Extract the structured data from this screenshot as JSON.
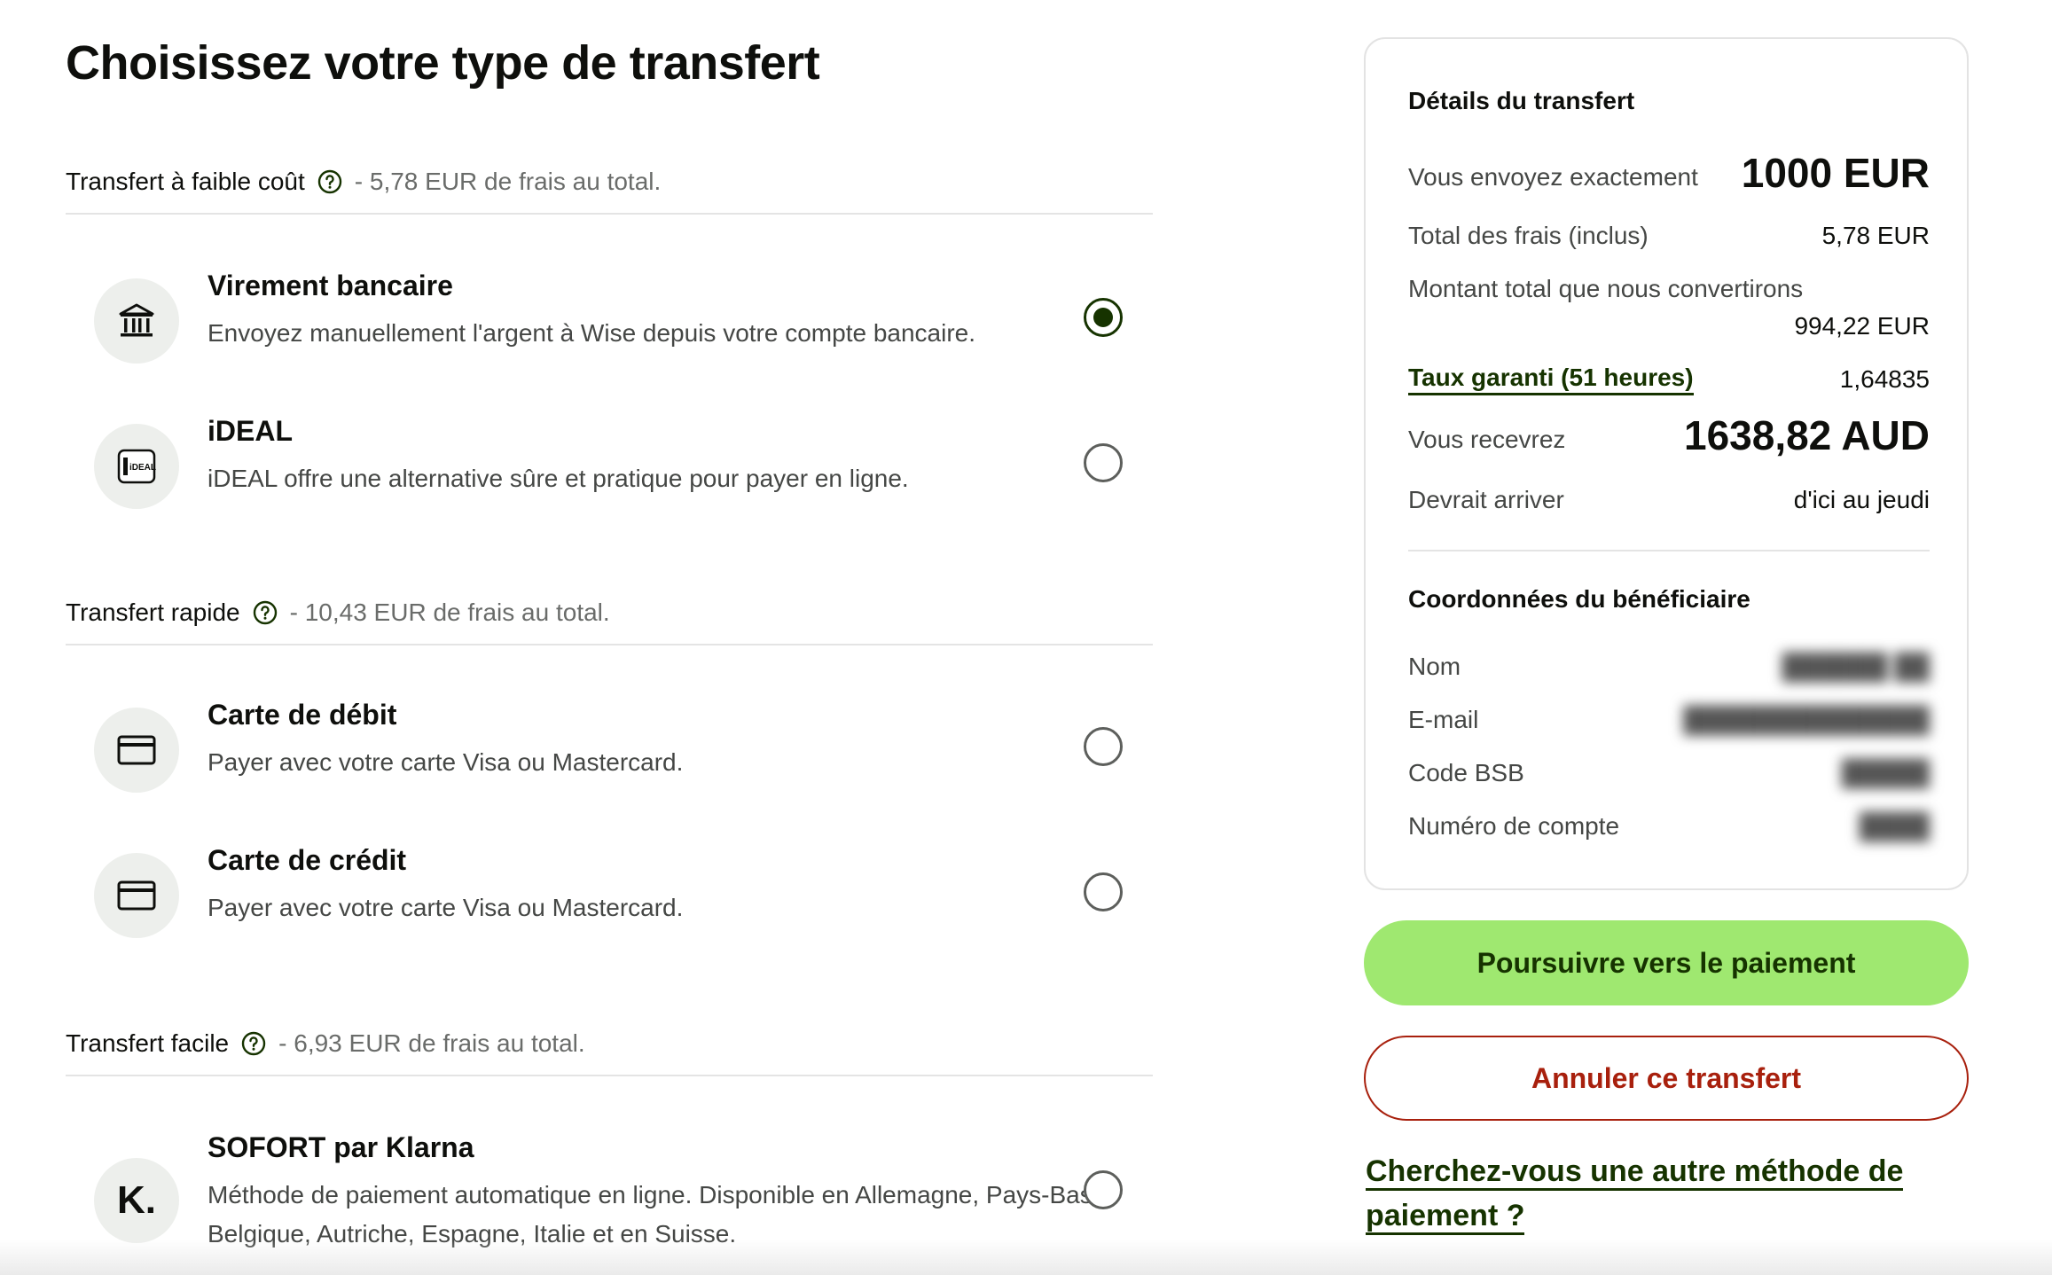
{
  "page_title": "Choisissez votre type de transfert",
  "groups": [
    {
      "title": "Transfert à faible coût",
      "fee": "- 5,78 EUR de frais au total.",
      "options": [
        {
          "title": "Virement bancaire",
          "description": "Envoyez manuellement l'argent à Wise depuis votre compte bancaire.",
          "icon": "bank-icon",
          "selected": true
        },
        {
          "title": "iDEAL",
          "description": "iDEAL offre une alternative sûre et pratique pour payer en ligne.",
          "icon": "ideal-logo-icon",
          "icon_text": "iDEAL",
          "selected": false
        }
      ]
    },
    {
      "title": "Transfert rapide",
      "fee": "- 10,43 EUR de frais au total.",
      "options": [
        {
          "title": "Carte de débit",
          "description": "Payer avec votre carte Visa ou Mastercard.",
          "icon": "card-icon",
          "selected": false
        },
        {
          "title": "Carte de crédit",
          "description": "Payer avec votre carte Visa ou Mastercard.",
          "icon": "card-icon",
          "selected": false
        }
      ]
    },
    {
      "title": "Transfert facile",
      "fee": "- 6,93 EUR de frais au total.",
      "options": [
        {
          "title": "SOFORT par Klarna",
          "description": "Méthode de paiement automatique en ligne. Disponible en Allemagne, Pays-Bas, Belgique, Autriche, Espagne, Italie et en Suisse.",
          "icon": "klarna-logo-icon",
          "icon_text": "K.",
          "selected": false
        }
      ]
    }
  ],
  "details": {
    "title": "Détails du transfert",
    "send_label": "Vous envoyez exactement",
    "send_value": "1000 EUR",
    "fees_label": "Total des frais (inclus)",
    "fees_value": "5,78 EUR",
    "convert_label": "Montant total que nous convertirons",
    "convert_value": "994,22 EUR",
    "rate_label": "Taux garanti (51 heures)",
    "rate_value": "1,64835",
    "receive_label": "Vous recevrez",
    "receive_value": "1638,82 AUD",
    "arrive_label": "Devrait arriver",
    "arrive_value": "d'ici au jeudi"
  },
  "recipient": {
    "title": "Coordonnées du bénéficiaire",
    "name_label": "Nom",
    "email_label": "E-mail",
    "bsb_label": "Code BSB",
    "account_label": "Numéro de compte"
  },
  "actions": {
    "continue_label": "Poursuivre vers le paiement",
    "cancel_label": "Annuler ce transfert",
    "other_method_label": "Cherchez-vous une autre méthode de paiement ?"
  },
  "colors": {
    "primary_green": "#9fe870",
    "forest_green": "#163300",
    "cancel_red": "#a8200d"
  }
}
